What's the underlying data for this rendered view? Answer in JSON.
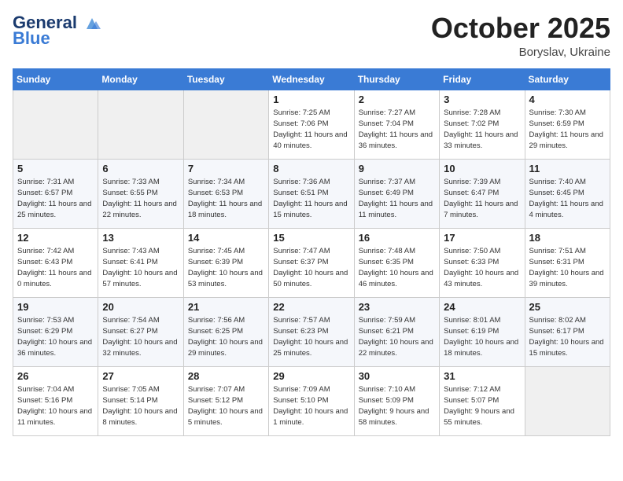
{
  "header": {
    "logo_line1": "General",
    "logo_line2": "Blue",
    "month": "October 2025",
    "location": "Boryslav, Ukraine"
  },
  "days_of_week": [
    "Sunday",
    "Monday",
    "Tuesday",
    "Wednesday",
    "Thursday",
    "Friday",
    "Saturday"
  ],
  "weeks": [
    [
      {
        "day": "",
        "info": ""
      },
      {
        "day": "",
        "info": ""
      },
      {
        "day": "",
        "info": ""
      },
      {
        "day": "1",
        "info": "Sunrise: 7:25 AM\nSunset: 7:06 PM\nDaylight: 11 hours\nand 40 minutes."
      },
      {
        "day": "2",
        "info": "Sunrise: 7:27 AM\nSunset: 7:04 PM\nDaylight: 11 hours\nand 36 minutes."
      },
      {
        "day": "3",
        "info": "Sunrise: 7:28 AM\nSunset: 7:02 PM\nDaylight: 11 hours\nand 33 minutes."
      },
      {
        "day": "4",
        "info": "Sunrise: 7:30 AM\nSunset: 6:59 PM\nDaylight: 11 hours\nand 29 minutes."
      }
    ],
    [
      {
        "day": "5",
        "info": "Sunrise: 7:31 AM\nSunset: 6:57 PM\nDaylight: 11 hours\nand 25 minutes."
      },
      {
        "day": "6",
        "info": "Sunrise: 7:33 AM\nSunset: 6:55 PM\nDaylight: 11 hours\nand 22 minutes."
      },
      {
        "day": "7",
        "info": "Sunrise: 7:34 AM\nSunset: 6:53 PM\nDaylight: 11 hours\nand 18 minutes."
      },
      {
        "day": "8",
        "info": "Sunrise: 7:36 AM\nSunset: 6:51 PM\nDaylight: 11 hours\nand 15 minutes."
      },
      {
        "day": "9",
        "info": "Sunrise: 7:37 AM\nSunset: 6:49 PM\nDaylight: 11 hours\nand 11 minutes."
      },
      {
        "day": "10",
        "info": "Sunrise: 7:39 AM\nSunset: 6:47 PM\nDaylight: 11 hours\nand 7 minutes."
      },
      {
        "day": "11",
        "info": "Sunrise: 7:40 AM\nSunset: 6:45 PM\nDaylight: 11 hours\nand 4 minutes."
      }
    ],
    [
      {
        "day": "12",
        "info": "Sunrise: 7:42 AM\nSunset: 6:43 PM\nDaylight: 11 hours\nand 0 minutes."
      },
      {
        "day": "13",
        "info": "Sunrise: 7:43 AM\nSunset: 6:41 PM\nDaylight: 10 hours\nand 57 minutes."
      },
      {
        "day": "14",
        "info": "Sunrise: 7:45 AM\nSunset: 6:39 PM\nDaylight: 10 hours\nand 53 minutes."
      },
      {
        "day": "15",
        "info": "Sunrise: 7:47 AM\nSunset: 6:37 PM\nDaylight: 10 hours\nand 50 minutes."
      },
      {
        "day": "16",
        "info": "Sunrise: 7:48 AM\nSunset: 6:35 PM\nDaylight: 10 hours\nand 46 minutes."
      },
      {
        "day": "17",
        "info": "Sunrise: 7:50 AM\nSunset: 6:33 PM\nDaylight: 10 hours\nand 43 minutes."
      },
      {
        "day": "18",
        "info": "Sunrise: 7:51 AM\nSunset: 6:31 PM\nDaylight: 10 hours\nand 39 minutes."
      }
    ],
    [
      {
        "day": "19",
        "info": "Sunrise: 7:53 AM\nSunset: 6:29 PM\nDaylight: 10 hours\nand 36 minutes."
      },
      {
        "day": "20",
        "info": "Sunrise: 7:54 AM\nSunset: 6:27 PM\nDaylight: 10 hours\nand 32 minutes."
      },
      {
        "day": "21",
        "info": "Sunrise: 7:56 AM\nSunset: 6:25 PM\nDaylight: 10 hours\nand 29 minutes."
      },
      {
        "day": "22",
        "info": "Sunrise: 7:57 AM\nSunset: 6:23 PM\nDaylight: 10 hours\nand 25 minutes."
      },
      {
        "day": "23",
        "info": "Sunrise: 7:59 AM\nSunset: 6:21 PM\nDaylight: 10 hours\nand 22 minutes."
      },
      {
        "day": "24",
        "info": "Sunrise: 8:01 AM\nSunset: 6:19 PM\nDaylight: 10 hours\nand 18 minutes."
      },
      {
        "day": "25",
        "info": "Sunrise: 8:02 AM\nSunset: 6:17 PM\nDaylight: 10 hours\nand 15 minutes."
      }
    ],
    [
      {
        "day": "26",
        "info": "Sunrise: 7:04 AM\nSunset: 5:16 PM\nDaylight: 10 hours\nand 11 minutes."
      },
      {
        "day": "27",
        "info": "Sunrise: 7:05 AM\nSunset: 5:14 PM\nDaylight: 10 hours\nand 8 minutes."
      },
      {
        "day": "28",
        "info": "Sunrise: 7:07 AM\nSunset: 5:12 PM\nDaylight: 10 hours\nand 5 minutes."
      },
      {
        "day": "29",
        "info": "Sunrise: 7:09 AM\nSunset: 5:10 PM\nDaylight: 10 hours\nand 1 minute."
      },
      {
        "day": "30",
        "info": "Sunrise: 7:10 AM\nSunset: 5:09 PM\nDaylight: 9 hours\nand 58 minutes."
      },
      {
        "day": "31",
        "info": "Sunrise: 7:12 AM\nSunset: 5:07 PM\nDaylight: 9 hours\nand 55 minutes."
      },
      {
        "day": "",
        "info": ""
      }
    ]
  ]
}
